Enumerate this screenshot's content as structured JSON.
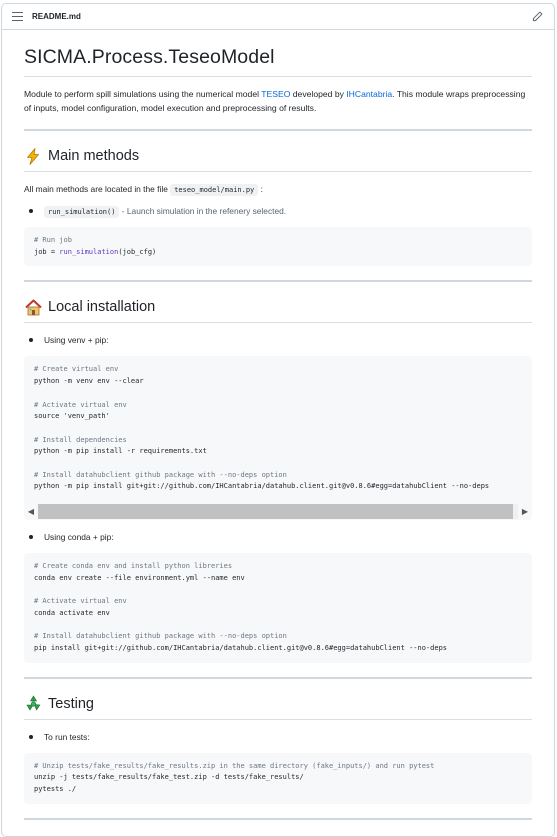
{
  "file": {
    "name": "README.md"
  },
  "title": "SICMA.Process.TeseoModel",
  "intro": {
    "text1": "Module to perform spill simulations using the numerical model ",
    "link1": "TESEO",
    "text2": " developed by ",
    "link2": "IHCantabria",
    "text3": ". This module wraps preprocessing of inputs, model configuration, model execution and preprocessing of results."
  },
  "main_methods": {
    "heading": "Main methods",
    "para_before": "All main methods are located in the file ",
    "file_code": "teseo_model/main.py",
    "para_after": " :",
    "bullet_code": "run_simulation()",
    "bullet_text": " - Launch simulation in the refenery selected.",
    "code_comment": "# Run job",
    "code_prefix": "job = ",
    "code_fn": "run_simulation",
    "code_suffix": "(job_cfg)"
  },
  "local_install": {
    "heading": "Local installation",
    "bullet1": "Using venv + pip:",
    "venv_lines": [
      {
        "c": "# Create virtual env",
        "t": "python -m venv env --clear"
      },
      {
        "c": "# Activate virtual env",
        "t": "source 'venv_path'"
      },
      {
        "c": "# Install dependencies",
        "t": "python -m pip install -r requirements.txt"
      },
      {
        "c": "# Install datahubclient github package with --no-deps option",
        "t": "python -m pip install git+git://github.com/IHCantabria/datahub.client.git@v0.8.6#egg=datahubClient --no-deps"
      }
    ],
    "bullet2": "Using conda + pip:",
    "conda_lines": [
      {
        "c": "# Create conda env and install python libreries",
        "t": "conda env create --file environment.yml --name env"
      },
      {
        "c": "# Activate virtual env",
        "t": "conda activate env"
      },
      {
        "c": "# Install datahubclient github package with --no-deps option",
        "t": "pip install git+git://github.com/IHCantabria/datahub.client.git@v0.8.6#egg=datahubClient --no-deps"
      }
    ]
  },
  "testing": {
    "heading": "Testing",
    "bullet": "To run tests:",
    "comment": "# Unzip tests/fake_results/fake_results.zip in the same directory (fake_inputs/) and run pytest",
    "line1": "unzip -j tests/fake_results/fake_test.zip -d tests/fake_results/",
    "line2": "pytests ./"
  },
  "icons": {
    "list": "list-icon",
    "edit": "pencil-icon",
    "main": "zap-icon",
    "house": "house-icon",
    "testing": "recycle-icon",
    "scroll_left": "caret-left-icon",
    "scroll_right": "caret-right-icon"
  },
  "colors": {
    "link": "#0969da",
    "border": "#d0d7de",
    "code_bg": "#f6f8fa",
    "comment": "#6e7781",
    "function": "#6639ba"
  }
}
